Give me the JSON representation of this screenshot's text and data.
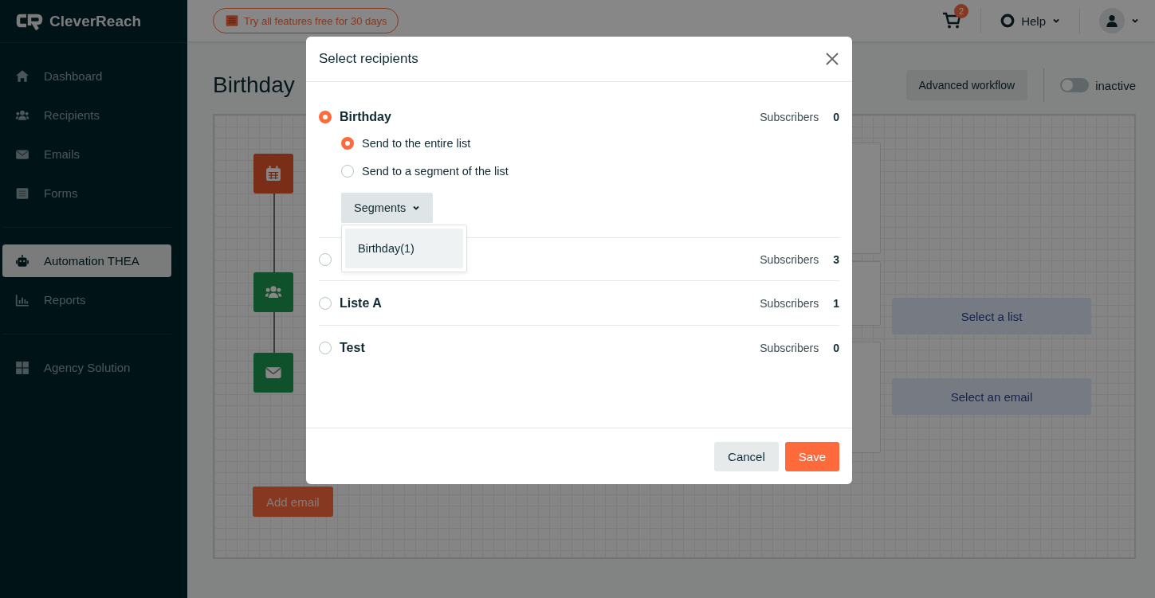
{
  "sidebar": {
    "logo": "CleverReach",
    "groups": [
      {
        "items": [
          {
            "label": "Dashboard",
            "selected": false
          },
          {
            "label": "Recipients",
            "selected": false
          },
          {
            "label": "Emails",
            "selected": false
          },
          {
            "label": "Forms",
            "selected": false
          }
        ]
      },
      {
        "items": [
          {
            "label": "Automation THEA",
            "selected": true
          },
          {
            "label": "Reports",
            "selected": false
          }
        ]
      },
      {
        "items": [
          {
            "label": "Agency Solution",
            "selected": false
          }
        ]
      }
    ]
  },
  "header": {
    "trial_badge": "Try all features free for 30 days",
    "cart_count": "2",
    "help": "Help"
  },
  "page": {
    "title": "Birthday",
    "advanced_button": "Advanced workflow",
    "toggle": {
      "label": "inactive",
      "on": false
    }
  },
  "canvas": {
    "nodes": [
      {
        "kind": "calendar"
      },
      {
        "kind": "users"
      },
      {
        "kind": "mail"
      }
    ],
    "select_list": "Select a list",
    "select_email": "Select an email",
    "add_email": "Add email"
  },
  "modal": {
    "title": "Select recipients",
    "lists": [
      {
        "name": "Birthday",
        "selected": true,
        "subscribers_label": "Subscribers",
        "count": "0",
        "send_options": [
          {
            "label": "Send to the entire list",
            "selected": true
          },
          {
            "label": "Send to a segment of the list",
            "selected": false
          }
        ],
        "segments_button": "Segments",
        "segments_menu": [
          "Birthday(1)"
        ]
      },
      {
        "selected": false,
        "subscribers_label": "Subscribers",
        "count": "3"
      },
      {
        "name": "Liste A",
        "selected": false,
        "subscribers_label": "Subscribers",
        "count": "1"
      },
      {
        "name": "Test",
        "selected": false,
        "subscribers_label": "Subscribers",
        "count": "0"
      }
    ],
    "cancel": "Cancel",
    "save": "Save"
  }
}
